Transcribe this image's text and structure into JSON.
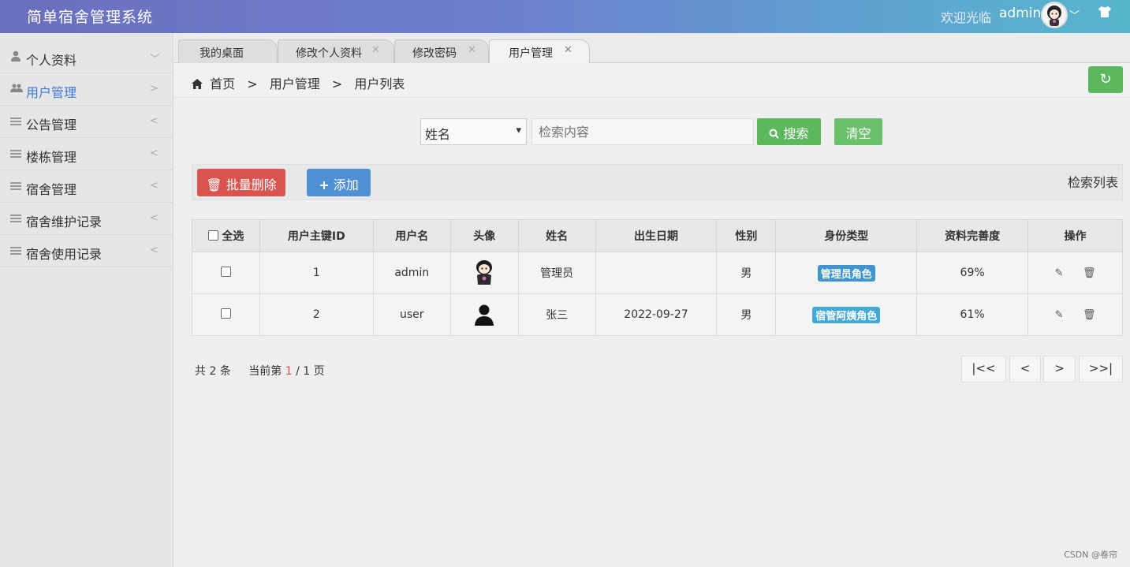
{
  "header": {
    "title": "简单宿舍管理系统",
    "welcome": "欢迎光临",
    "username": "admin",
    "colors": {
      "gradient_start": "#6a6fbe",
      "gradient_end": "#57b6cc"
    }
  },
  "sidebar": {
    "items": [
      {
        "label": "个人资料",
        "icon": "user-icon",
        "arrow": "chevron-down-icon"
      },
      {
        "label": "用户管理",
        "icon": "users-icon",
        "arrow": "chevron-right-icon",
        "active": true
      },
      {
        "label": "公告管理",
        "icon": "menu-icon",
        "arrow": "chevron-left-icon"
      },
      {
        "label": "楼栋管理",
        "icon": "menu-icon",
        "arrow": "chevron-left-icon"
      },
      {
        "label": "宿舍管理",
        "icon": "menu-icon",
        "arrow": "chevron-left-icon"
      },
      {
        "label": "宿舍维护记录",
        "icon": "menu-icon",
        "arrow": "chevron-left-icon"
      },
      {
        "label": "宿舍使用记录",
        "icon": "menu-icon",
        "arrow": "chevron-left-icon"
      }
    ]
  },
  "tabs": [
    {
      "label": "我的桌面",
      "closable": false
    },
    {
      "label": "修改个人资料",
      "closable": true
    },
    {
      "label": "修改密码",
      "closable": true
    },
    {
      "label": "用户管理",
      "closable": true,
      "active": true
    }
  ],
  "breadcrumb": [
    "首页",
    ">",
    "用户管理",
    ">",
    "用户列表"
  ],
  "search": {
    "field_selected": "姓名",
    "placeholder": "检索内容",
    "search_label": "搜索",
    "clear_label": "清空"
  },
  "toolbar": {
    "batch_delete_label": "批量删除",
    "add_label": "添加",
    "list_label": "检索列表"
  },
  "table": {
    "select_all_label": "全选",
    "columns": [
      "用户主键ID",
      "用户名",
      "头像",
      "姓名",
      "出生日期",
      "性别",
      "身份类型",
      "资料完善度",
      "操作"
    ],
    "rows": [
      {
        "id": "1",
        "username": "admin",
        "avatar": "cartoon-avatar-icon",
        "name": "管理员",
        "birth": "",
        "gender": "男",
        "role": "管理员角色",
        "completeness": "69%"
      },
      {
        "id": "2",
        "username": "user",
        "avatar": "default-user-icon",
        "name": "张三",
        "birth": "2022-09-27",
        "gender": "男",
        "role": "宿管阿姨角色",
        "completeness": "61%"
      }
    ]
  },
  "pager": {
    "total_prefix": "共",
    "total": "2",
    "total_suffix": "条",
    "current_prefix": "当前第",
    "current_page": "1",
    "total_pages_text": "/ 1 页",
    "first": "|<<",
    "prev": "<",
    "next": ">",
    "last": ">>|"
  },
  "watermark": "CSDN @卷帘"
}
